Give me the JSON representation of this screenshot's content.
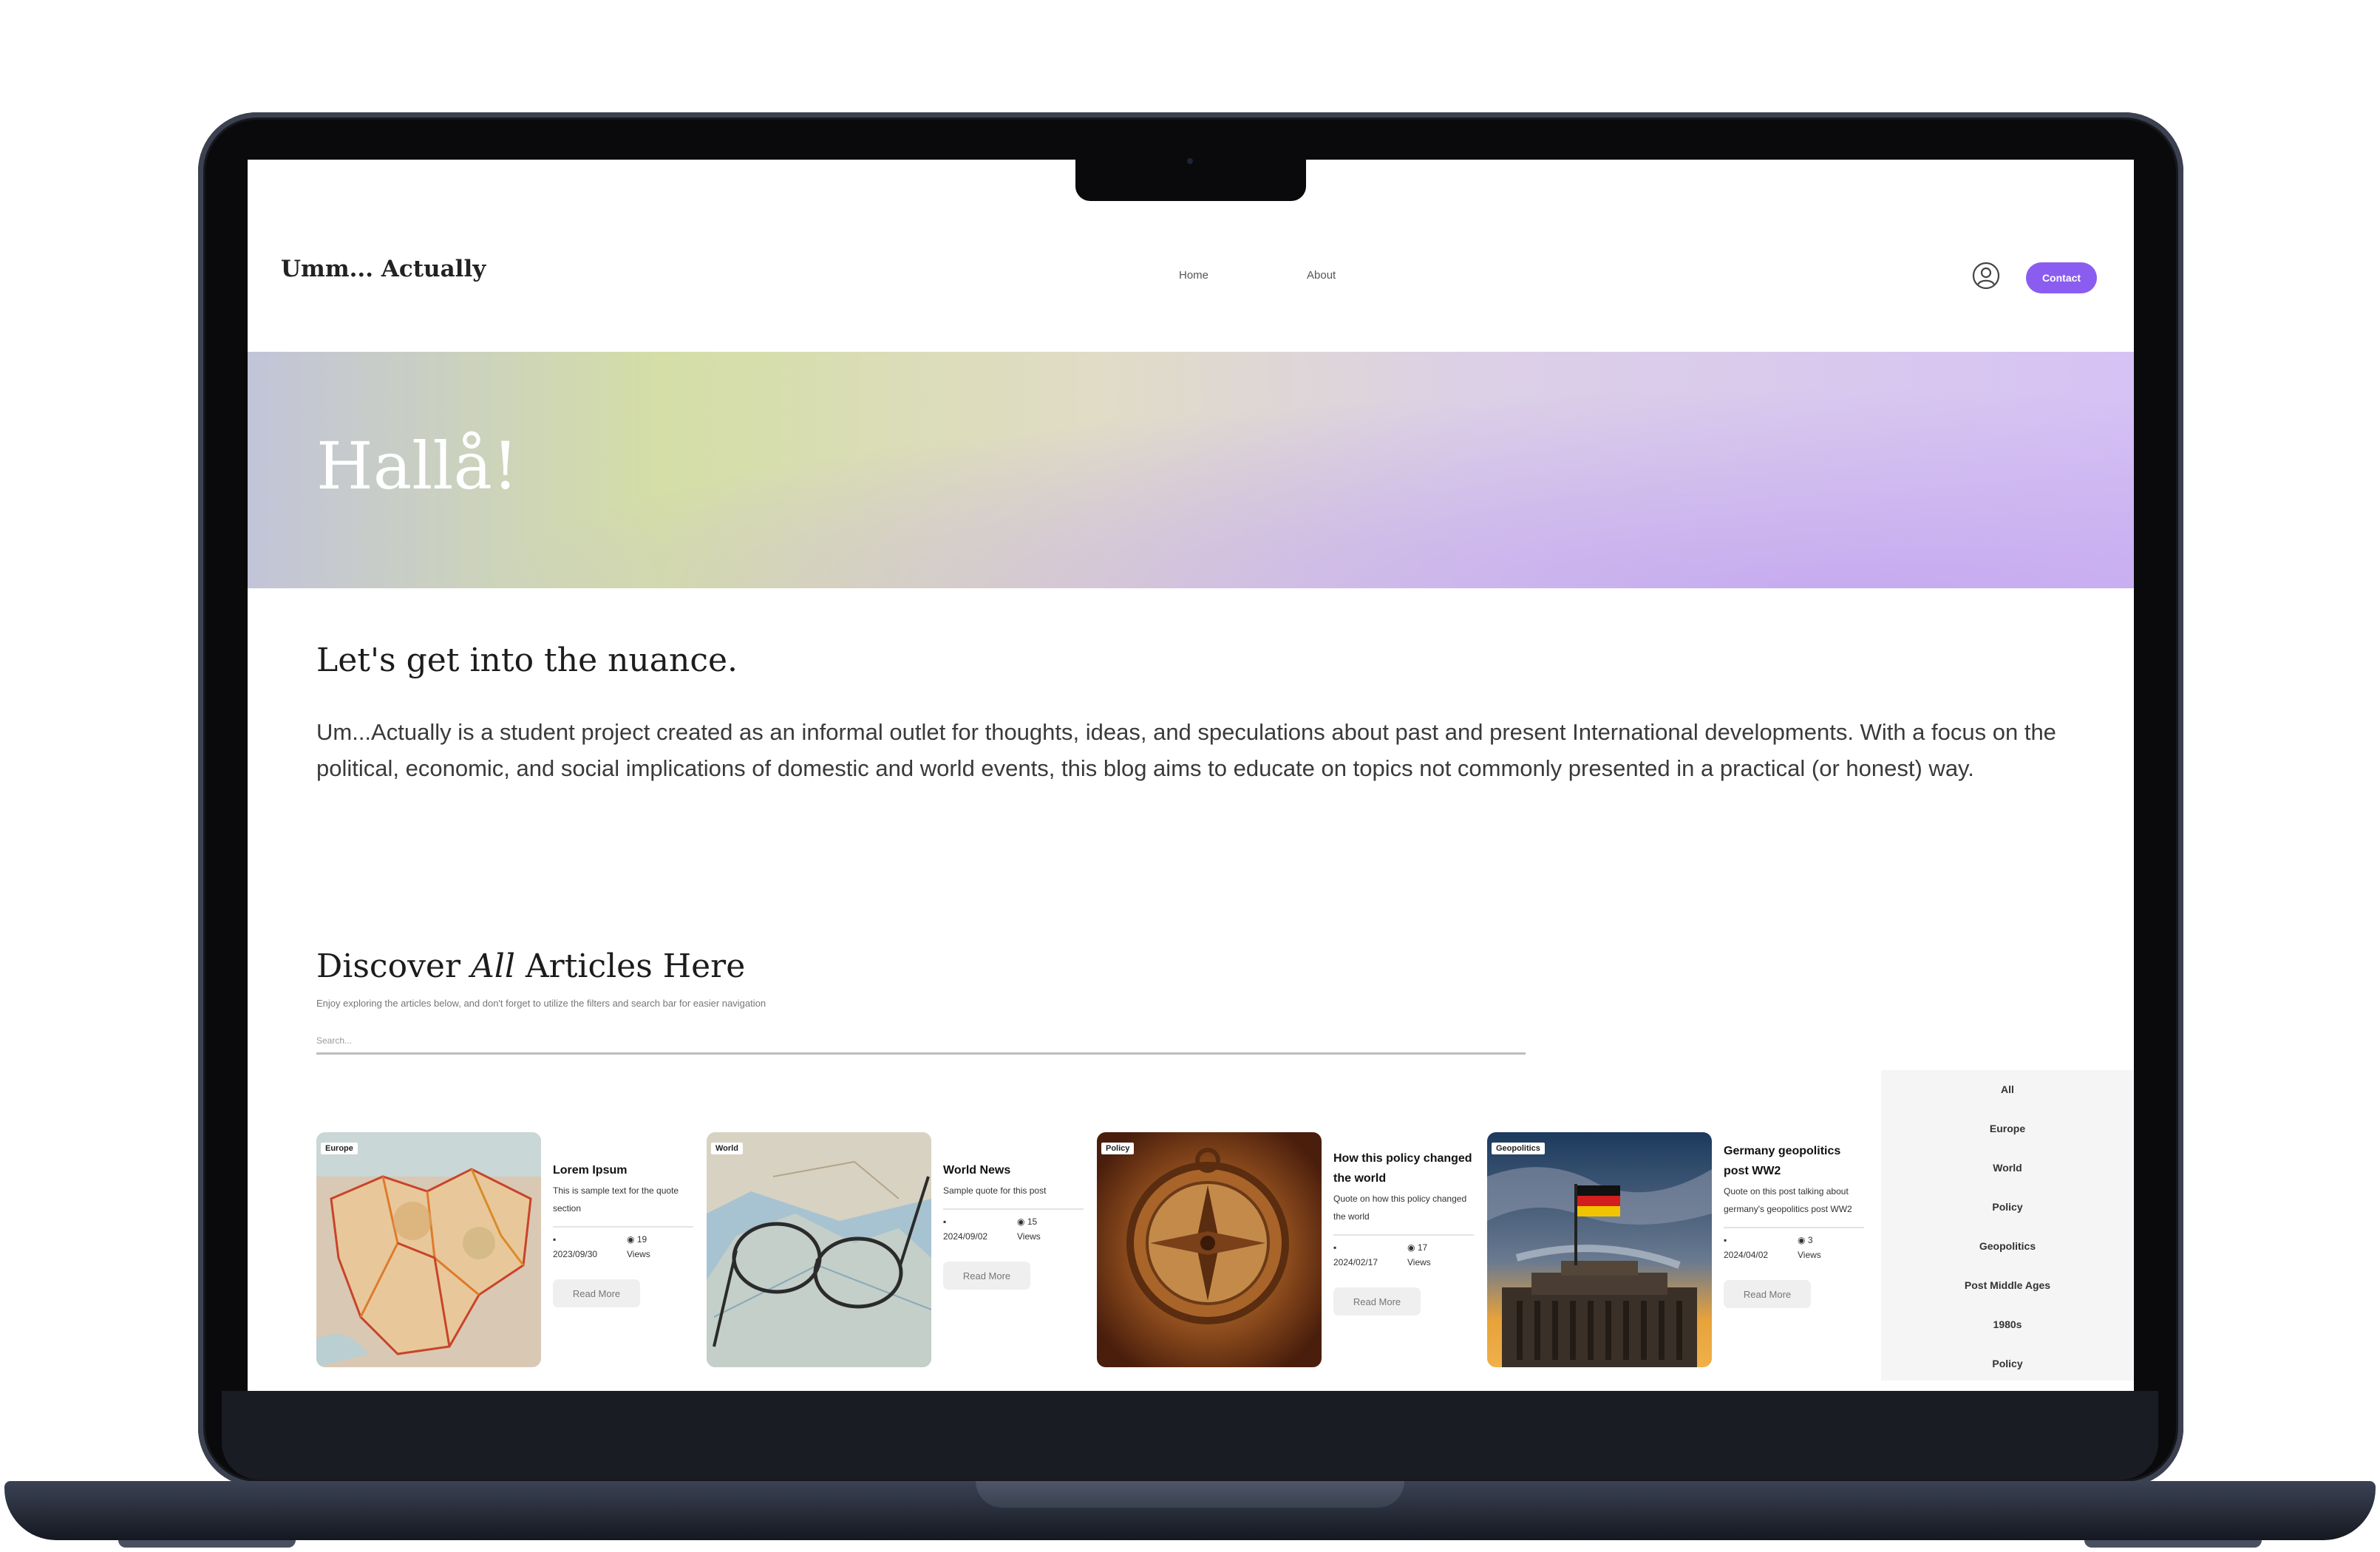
{
  "site": {
    "logo": "Umm... Actually"
  },
  "nav": {
    "home": "Home",
    "about": "About",
    "contact": "Contact"
  },
  "hero": {
    "title": "Hallå!"
  },
  "intro": {
    "title": "Let's get into the nuance.",
    "body": "Um...Actually is a student project created as an informal outlet for thoughts, ideas, and speculations about past and present International developments. With a focus on the political, economic, and social implications of domestic and world events, this blog aims to educate on topics not commonly presented in a practical (or honest) way."
  },
  "articles_section": {
    "title_prefix": "Discover ",
    "title_emphasis": "All",
    "title_suffix": " Articles Here",
    "subtitle": "Enjoy exploring the articles below, and don't forget to utilize the filters and search bar for easier navigation",
    "search_placeholder": "Search..."
  },
  "articles": [
    {
      "tag": "Europe",
      "title": "Lorem Ipsum",
      "quote": "This is sample text for the quote section",
      "date": "2023/09/30",
      "views": "19",
      "views_label": "Views",
      "read_more": "Read More"
    },
    {
      "tag": "World",
      "title": "World News",
      "quote": "Sample quote for this post",
      "date": "2024/09/02",
      "views": "15",
      "views_label": "Views",
      "read_more": "Read More"
    },
    {
      "tag": "Policy",
      "title": "How this policy changed the world",
      "quote": "Quote on how this policy changed the world",
      "date": "2024/02/17",
      "views": "17",
      "views_label": "Views",
      "read_more": "Read More"
    },
    {
      "tag": "Geopolitics",
      "title": "Germany geopolitics post WW2",
      "quote": "Quote on this post talking about germany's geopolitics post WW2",
      "date": "2024/04/02",
      "views": "3",
      "views_label": "Views",
      "read_more": "Read More"
    }
  ],
  "filters": [
    "All",
    "Europe",
    "World",
    "Policy",
    "Geopolitics",
    "Post Middle Ages",
    "1980s",
    "Policy"
  ],
  "colors": {
    "accent": "#8a5df0",
    "hero_left": "#c2c4d8",
    "hero_mid": "#d4dea6",
    "hero_right": "#d6c2f4"
  }
}
